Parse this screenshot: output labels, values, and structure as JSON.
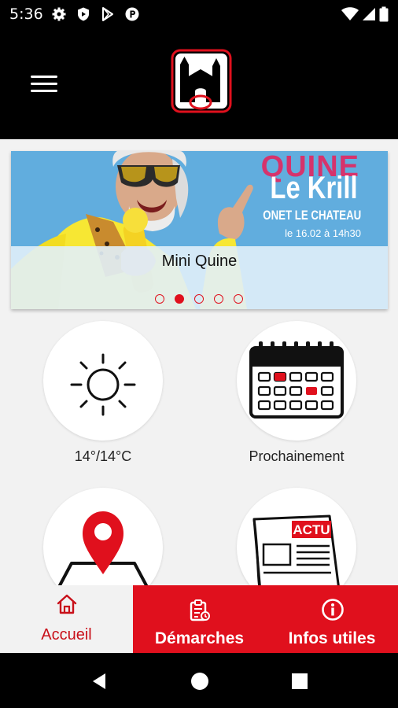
{
  "status_bar": {
    "time": "5:36",
    "left_icons": [
      "settings-icon",
      "shield-icon",
      "play-store-icon",
      "circle-p-icon"
    ],
    "right_icons": [
      "wifi-icon",
      "signal-icon",
      "battery-icon"
    ]
  },
  "app_bar": {
    "menu_icon": "hamburger-icon",
    "logo": "castle-logo"
  },
  "banner": {
    "headline_1": "QUINE",
    "headline_2": "Le Krill",
    "headline_3": "ONET LE CHATEAU",
    "headline_4": "le 16.02 à 14h30",
    "caption": "Mini Quine",
    "slides_total": 5,
    "active_slide": 2
  },
  "tiles": [
    {
      "label": "14°/14°C",
      "icon": "sun-icon"
    },
    {
      "label": "Prochainement",
      "icon": "calendar-icon"
    },
    {
      "label": "",
      "icon": "map-pin-icon"
    },
    {
      "label": "",
      "icon": "newspaper-icon",
      "icon_text": "ACTU"
    }
  ],
  "bottom_nav": {
    "items": [
      {
        "label": "Accueil",
        "icon": "home-icon",
        "active": true
      },
      {
        "label": "Démarches",
        "icon": "clipboard-icon",
        "active": false
      },
      {
        "label": "Infos utiles",
        "icon": "info-icon",
        "active": false
      }
    ]
  },
  "colors": {
    "accent": "#e0101d",
    "bar": "#000000",
    "background": "#f2f2f2",
    "banner_sky": "#5aa9dc",
    "banner_pink": "#d6336c"
  }
}
